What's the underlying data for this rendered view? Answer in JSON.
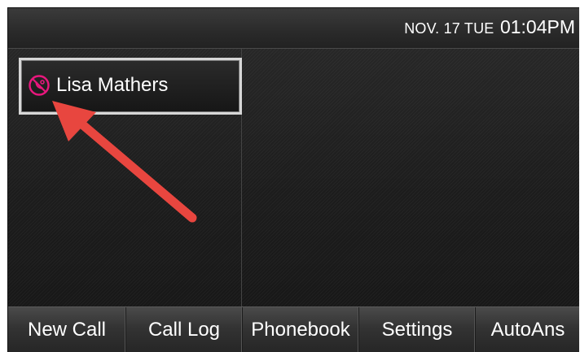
{
  "status_bar": {
    "date": "NOV. 17 TUE",
    "time": "01:04PM"
  },
  "line": {
    "name": "Lisa Mathers",
    "icon": "call-status-icon",
    "icon_color": "#e8177d"
  },
  "annotation": {
    "arrow_color": "#e8463f"
  },
  "softkeys": [
    {
      "label": "New Call"
    },
    {
      "label": "Call Log"
    },
    {
      "label": "Phonebook"
    },
    {
      "label": "Settings"
    },
    {
      "label": "AutoAns"
    }
  ]
}
